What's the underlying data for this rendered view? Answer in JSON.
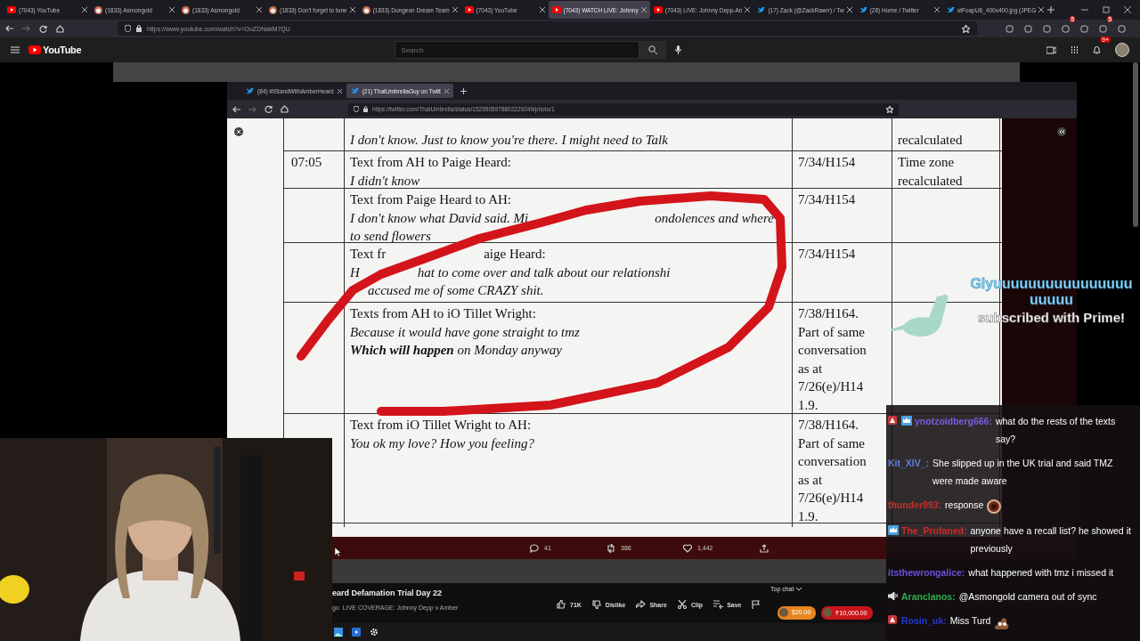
{
  "browser": {
    "tabs": [
      {
        "title": "(7043) YouTube",
        "kind": "youtube",
        "selected": false
      },
      {
        "title": "(1833) Asmongold",
        "kind": "channel",
        "selected": false
      },
      {
        "title": "(1833) Asmongold",
        "kind": "channel",
        "selected": false
      },
      {
        "title": "(1833) Don't forget to tune",
        "kind": "channel",
        "selected": false
      },
      {
        "title": "(1833) Dungeon Dream Team",
        "kind": "channel",
        "selected": false
      },
      {
        "title": "(7043) YouTube",
        "kind": "youtube",
        "selected": false
      },
      {
        "title": "(7043) WATCH LIVE: Johnny",
        "kind": "youtube",
        "selected": true
      },
      {
        "title": "(7043) LIVE: Johnny Depp-An",
        "kind": "youtube",
        "selected": false
      },
      {
        "title": "(17) Zack (@ZackRawrr) / Tw",
        "kind": "twitter",
        "selected": false
      },
      {
        "title": "(28) Home / Twitter",
        "kind": "twitter",
        "selected": false
      },
      {
        "title": "otFoapU6_400x400.jpg (JPEG",
        "kind": "twitter",
        "selected": false
      }
    ],
    "url": "https://www.youtube.com/watch?v=OuZDNakM7QU",
    "extension_badges": [
      "5",
      "5"
    ]
  },
  "youtube_header": {
    "logo": "YouTube",
    "search": {
      "placeholder": "Search"
    },
    "notification_badge": "9+"
  },
  "embedded_window": {
    "tabs": [
      {
        "title": "(84) #IStandWithAmberHeard",
        "selected": false
      },
      {
        "title": "(21) ThatUmbrellaGuy on Twitt",
        "selected": true
      }
    ],
    "url": "https://twitter.com/ThatUmbrella/status/1529505978802229249/photo/1"
  },
  "document": {
    "rows": [
      {
        "lines": [
          {
            "italic": true,
            "segments": [
              "I don't know. Just to know you're there. I might need to Talk"
            ]
          }
        ],
        "note": [
          "recalculated"
        ]
      },
      {
        "time": "07:05",
        "lines": [
          {
            "italic": false,
            "segments": [
              "Text from AH to Paige Heard:"
            ]
          },
          {
            "italic": true,
            "segments": [
              "I didn't know"
            ]
          }
        ],
        "ref": [
          "7/34/H154"
        ],
        "note": [
          "Time zone",
          "recalculated"
        ]
      },
      {
        "lines": [
          {
            "italic": false,
            "segments": [
              "Text from Paige Heard to AH:"
            ]
          },
          {
            "italic": true,
            "segments": [
              "I don't know what David said. Mi",
              "ondolences and where"
            ]
          },
          {
            "italic": true,
            "segments": [
              "to send flowers"
            ]
          }
        ],
        "ref": [
          "7/34/H154"
        ]
      },
      {
        "lines": [
          {
            "italic": false,
            "segments": [
              "Text fr",
              "aige Heard:"
            ]
          },
          {
            "italic": true,
            "segments": [
              "H",
              "hat to come over and talk about our relationshi"
            ]
          },
          {
            "italic": true,
            "segments": [
              "accused me of some CRAZY shit."
            ]
          }
        ],
        "ref": [
          "7/34/H154"
        ]
      },
      {
        "lines": [
          {
            "italic": false,
            "segments": [
              "Texts from AH to iO Tillet Wright:"
            ]
          },
          {
            "italic": true,
            "segments": [
              "Because it would have gone straight to tmz"
            ]
          },
          {
            "italic": true,
            "segments": [
              "**Which will happen** on Monday anyway"
            ]
          }
        ],
        "ref": [
          "7/38/H164.",
          "Part of same",
          "conversation",
          "as at",
          "7/26(e)/H14",
          "1.9."
        ]
      },
      {
        "lines": [
          {
            "italic": false,
            "segments": [
              "Text from iO Tillet Wright to AH:"
            ]
          },
          {
            "italic": true,
            "segments": [
              "You ok my love? How you feeling?"
            ]
          }
        ],
        "ref": [
          "7/38/H164.",
          "Part of same",
          "conversation",
          "as at",
          "7/26(e)/H14",
          "1.9."
        ]
      }
    ]
  },
  "tweet_actions": [
    {
      "kind": "reply",
      "count": "41"
    },
    {
      "kind": "retweet",
      "count": "386"
    },
    {
      "kind": "like",
      "count": "1,442"
    },
    {
      "kind": "share"
    }
  ],
  "video": {
    "title": "eard Defamation Trial Day 22",
    "channel": "go",
    "subtitle": "LIVE COVERAGE: Johnny Depp v Amber",
    "actions": [
      {
        "kind": "like",
        "label": "71K"
      },
      {
        "kind": "dislike",
        "label": "Dislike"
      },
      {
        "kind": "share",
        "label": "Share"
      },
      {
        "kind": "clip",
        "label": "Clip"
      },
      {
        "kind": "save",
        "label": "Save"
      },
      {
        "kind": "flag"
      }
    ]
  },
  "live_chat": {
    "header": "Top chat",
    "super_chats": [
      {
        "amount": "$20.00",
        "color": "#e8851f"
      },
      {
        "amount": "₹10,000.00",
        "color": "#c8151b"
      }
    ]
  },
  "alert": {
    "name": "Giyuuuuuuuuuuuuuuuuuuuuu",
    "message": "subscribed with Prime!"
  },
  "chat": [
    {
      "badges": [
        {
          "kind": "letter"
        },
        {
          "kind": "crown"
        }
      ],
      "user": "ynotzoidberg666:",
      "color": "#7c5ce0",
      "text": "what do the rests of the texts say?"
    },
    {
      "user": "Kit_XIV_:",
      "color": "#5c7fe0",
      "text": "She slipped up in the UK trial and said TMZ were made aware"
    },
    {
      "user": "thunder993:",
      "color": "#c4302b",
      "text": "response",
      "emote": {
        "kind": "donut"
      }
    },
    {
      "badges": [
        {
          "kind": "crown"
        }
      ],
      "user": "The_Profaned:",
      "color": "#d02a2a",
      "text": "anyone have a recall list? he showed it previously"
    },
    {
      "user": "itsthewrongalice:",
      "color": "#6a4fe0",
      "text": "what happened with tmz i missed it"
    },
    {
      "badges": [
        {
          "kind": "mute"
        }
      ],
      "user": "Aranclanos:",
      "color": "#2fae4a",
      "text": "@Asmongold camera out of sync"
    },
    {
      "badges": [
        {
          "kind": "letter"
        }
      ],
      "user": "Rosin_uk:",
      "color": "#2438d8",
      "text": "Miss Turd",
      "emote": {
        "kind": "poop"
      }
    }
  ]
}
